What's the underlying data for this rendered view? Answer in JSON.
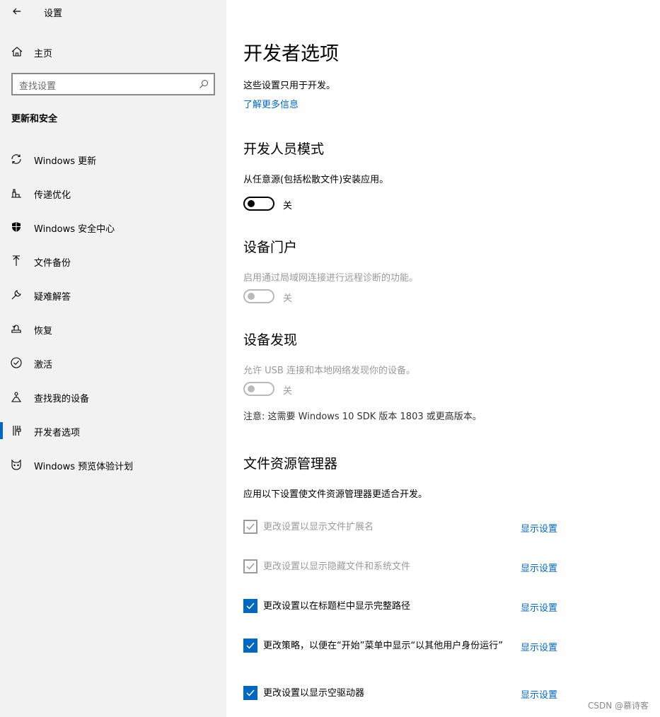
{
  "window": {
    "title": "设置"
  },
  "sidebar": {
    "home_label": "主页",
    "search_placeholder": "查找设置",
    "section_title": "更新和安全",
    "items": [
      {
        "label": "Windows 更新",
        "icon": "sync-icon"
      },
      {
        "label": "传递优化",
        "icon": "delivery-optimization-icon"
      },
      {
        "label": "Windows 安全中心",
        "icon": "shield-icon"
      },
      {
        "label": "文件备份",
        "icon": "backup-arrow-icon"
      },
      {
        "label": "疑难解答",
        "icon": "wrench-icon"
      },
      {
        "label": "恢复",
        "icon": "recovery-icon"
      },
      {
        "label": "激活",
        "icon": "check-circle-icon"
      },
      {
        "label": "查找我的设备",
        "icon": "find-device-icon"
      },
      {
        "label": "开发者选项",
        "icon": "developer-tools-icon",
        "selected": true
      },
      {
        "label": "Windows 预览体验计划",
        "icon": "insider-cat-icon"
      }
    ]
  },
  "main": {
    "title": "开发者选项",
    "description": "这些设置只用于开发。",
    "learn_more": "了解更多信息",
    "developer_mode": {
      "heading": "开发人员模式",
      "text": "从任意源(包括松散文件)安装应用。",
      "state_label": "关"
    },
    "device_portal": {
      "heading": "设备门户",
      "text": "启用通过局域网连接进行远程诊断的功能。",
      "state_label": "关"
    },
    "device_discovery": {
      "heading": "设备发现",
      "text": "允许 USB 连接和本地网络发现你的设备。",
      "state_label": "关",
      "note": "注意: 这需要 Windows 10 SDK 版本 1803 或更高版本。"
    },
    "file_explorer": {
      "heading": "文件资源管理器",
      "text": "应用以下设置使文件资源管理器更适合开发。",
      "rows": [
        {
          "label": "更改设置以显示文件扩展名",
          "link": "显示设置",
          "checked": true,
          "disabled": true
        },
        {
          "label": "更改设置以显示隐藏文件和系统文件",
          "link": "显示设置",
          "checked": true,
          "disabled": true
        },
        {
          "label": "更改设置以在标题栏中显示完整路径",
          "link": "显示设置",
          "checked": true,
          "disabled": false
        },
        {
          "label": "更改策略，以便在“开始”菜单中显示“以其他用户身份运行”",
          "link": "显示设置",
          "checked": true,
          "disabled": false
        },
        {
          "label": "更改设置以显示空驱动器",
          "link": "显示设置",
          "checked": true,
          "disabled": false
        }
      ]
    }
  },
  "watermark": "CSDN @慕诗客",
  "colors": {
    "accent": "#0067c0",
    "sidebar_bg": "#f2f2f2",
    "disabled": "#9a9a9a"
  }
}
